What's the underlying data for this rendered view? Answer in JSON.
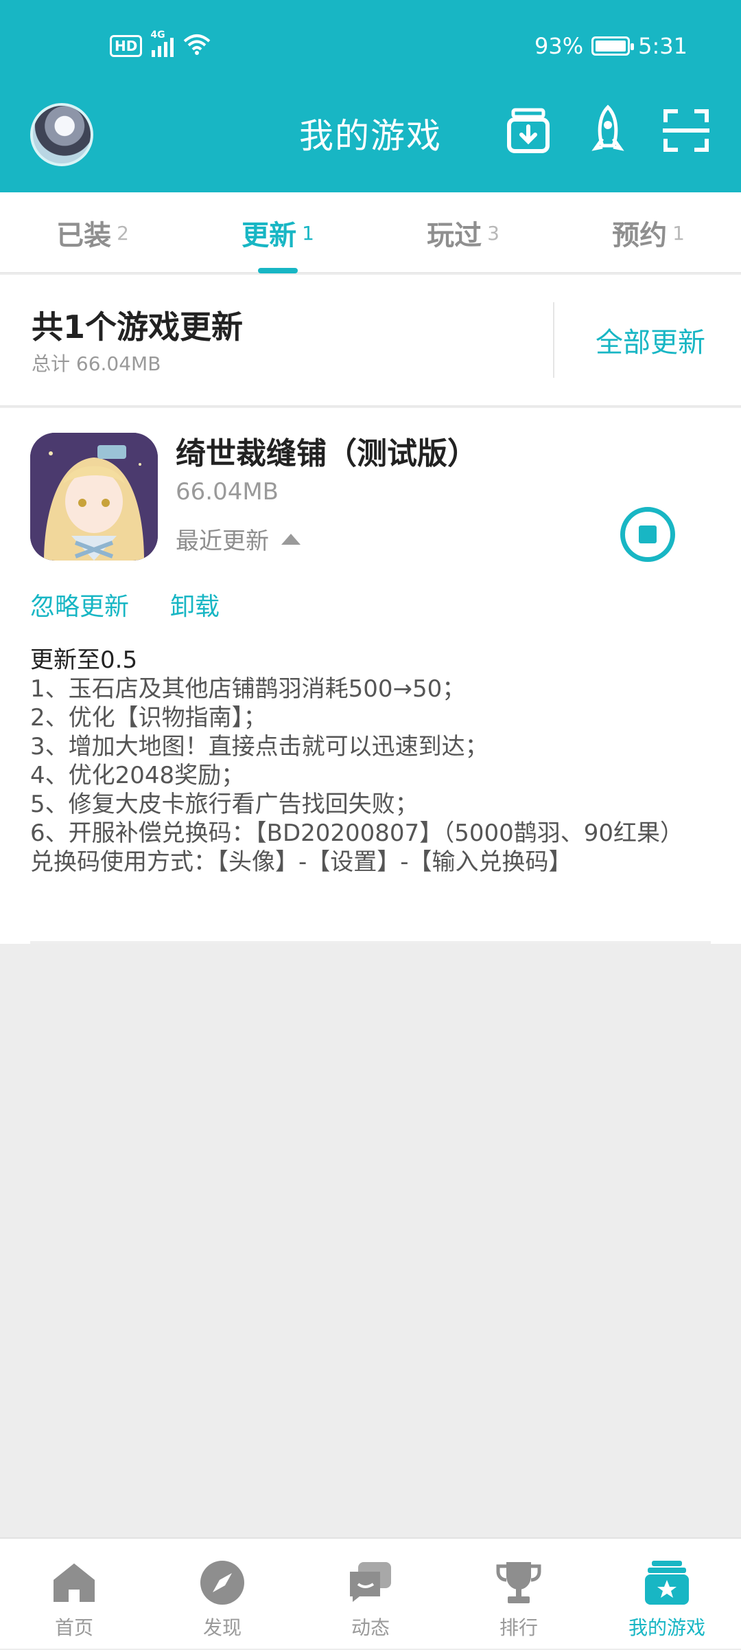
{
  "status_bar": {
    "network_badge": "HD",
    "signal_label": "4G",
    "battery": "93%",
    "time": "5:31"
  },
  "header": {
    "title": "我的游戏",
    "icons": [
      "avatar",
      "download-manager-icon",
      "rocket-icon",
      "scan-icon"
    ]
  },
  "tabs": [
    {
      "label": "已装",
      "count": "2"
    },
    {
      "label": "更新",
      "count": "1"
    },
    {
      "label": "玩过",
      "count": "3"
    },
    {
      "label": "预约",
      "count": "1"
    }
  ],
  "summary": {
    "title": "共1个游戏更新",
    "total": "总计  66.04MB",
    "update_all": "全部更新"
  },
  "game": {
    "name": "绮世裁缝铺（测试版）",
    "size": "66.04MB",
    "recent_label": "最近更新",
    "ignore": "忽略更新",
    "uninstall": "卸载",
    "notes_title": "更新至0.5",
    "notes": [
      "1、玉石店及其他店铺鹊羽消耗500→50；",
      "2、优化【识物指南】；",
      "3、增加大地图！直接点击就可以迅速到达；",
      "4、优化2048奖励；",
      "5、修复大皮卡旅行看广告找回失败；",
      "6、开服补偿兑换码：【BD20200807】（5000鹊羽、90红果）",
      "兑换码使用方式：【头像】-【设置】-【输入兑换码】"
    ]
  },
  "bottom_nav": [
    {
      "label": "首页",
      "icon": "home-icon"
    },
    {
      "label": "发现",
      "icon": "compass-icon"
    },
    {
      "label": "动态",
      "icon": "chat-icon"
    },
    {
      "label": "排行",
      "icon": "trophy-icon"
    },
    {
      "label": "我的游戏",
      "icon": "my-games-icon"
    }
  ],
  "colors": {
    "accent": "#18b6c4",
    "background": "#ededed"
  }
}
